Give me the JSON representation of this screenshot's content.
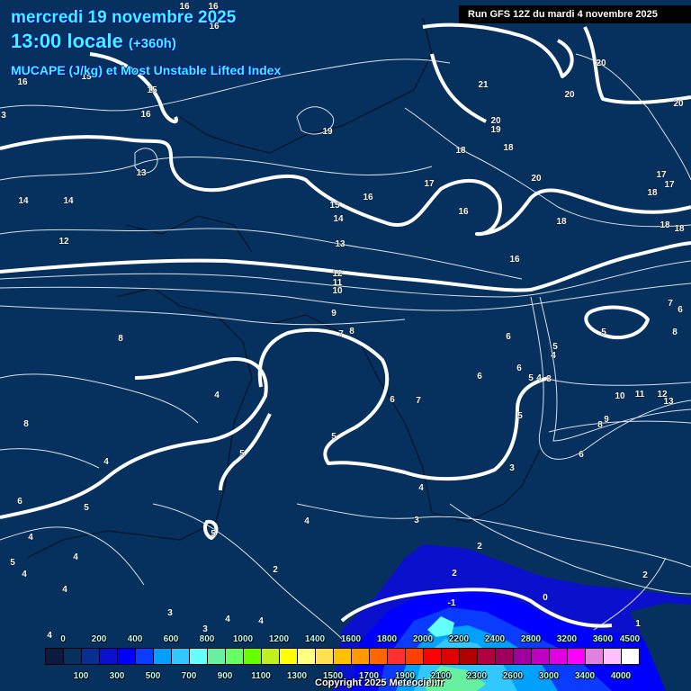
{
  "header": {
    "date": "mercredi 19 novembre 2025",
    "time": "13:00 locale",
    "lead": "(+360h)",
    "parameter": "MUCAPE (J/kg) et Most Unstable Lifted Index",
    "run": "Run GFS 12Z du mardi 4 novembre 2025"
  },
  "legend": {
    "colors": [
      "#0a1a40",
      "#06305e",
      "#063090",
      "#0a10cc",
      "#0000ff",
      "#0a3cff",
      "#00a0ff",
      "#30c8ff",
      "#66ffff",
      "#66f0a0",
      "#66ff66",
      "#66ff00",
      "#c0f020",
      "#ffff00",
      "#ffff80",
      "#ffe050",
      "#ffc000",
      "#ff9900",
      "#ff6600",
      "#ff3030",
      "#ff4000",
      "#ff0000",
      "#e00000",
      "#b00000",
      "#b00040",
      "#a00060",
      "#a000a0",
      "#c000c0",
      "#e000e0",
      "#ff00ff",
      "#e080e0",
      "#ffc0ff",
      "#ffffff"
    ],
    "top_labels": [
      "0",
      "200",
      "400",
      "600",
      "800",
      "1000",
      "1200",
      "1400",
      "1600",
      "1800",
      "2000",
      "2200",
      "2400",
      "2800",
      "3200",
      "3600",
      "4500"
    ],
    "bottom_labels": [
      "100",
      "300",
      "500",
      "700",
      "900",
      "1100",
      "1300",
      "1500",
      "1700",
      "1900",
      "2100",
      "2300",
      "2600",
      "3000",
      "3400",
      "4000"
    ]
  },
  "contour_labels": [
    "16",
    "15",
    "15",
    "16",
    "14",
    "14",
    "12",
    "13",
    "3",
    "16",
    "16",
    "16",
    "19",
    "21",
    "20",
    "19",
    "18",
    "18",
    "20",
    "20",
    "20",
    "20",
    "17",
    "17",
    "18",
    "18",
    "18",
    "18",
    "17",
    "16",
    "15",
    "14",
    "13",
    "16",
    "16",
    "12",
    "11",
    "10",
    "9",
    "7",
    "8",
    "8",
    "8",
    "4",
    "5",
    "4",
    "6",
    "5",
    "4",
    "5",
    "4",
    "4",
    "4",
    "4",
    "3",
    "3",
    "4",
    "4",
    "2",
    "4",
    "5",
    "5",
    "6",
    "7",
    "4",
    "3",
    "2",
    "2",
    "-1",
    "0",
    "2",
    "1",
    "6",
    "6",
    "6",
    "5",
    "4",
    "5",
    "5",
    "4",
    "3",
    "5",
    "3",
    "6",
    "8",
    "9",
    "10",
    "11",
    "12",
    "13",
    "7",
    "6",
    "8"
  ],
  "copyright": "Copyright 2025 Meteociel.fr"
}
